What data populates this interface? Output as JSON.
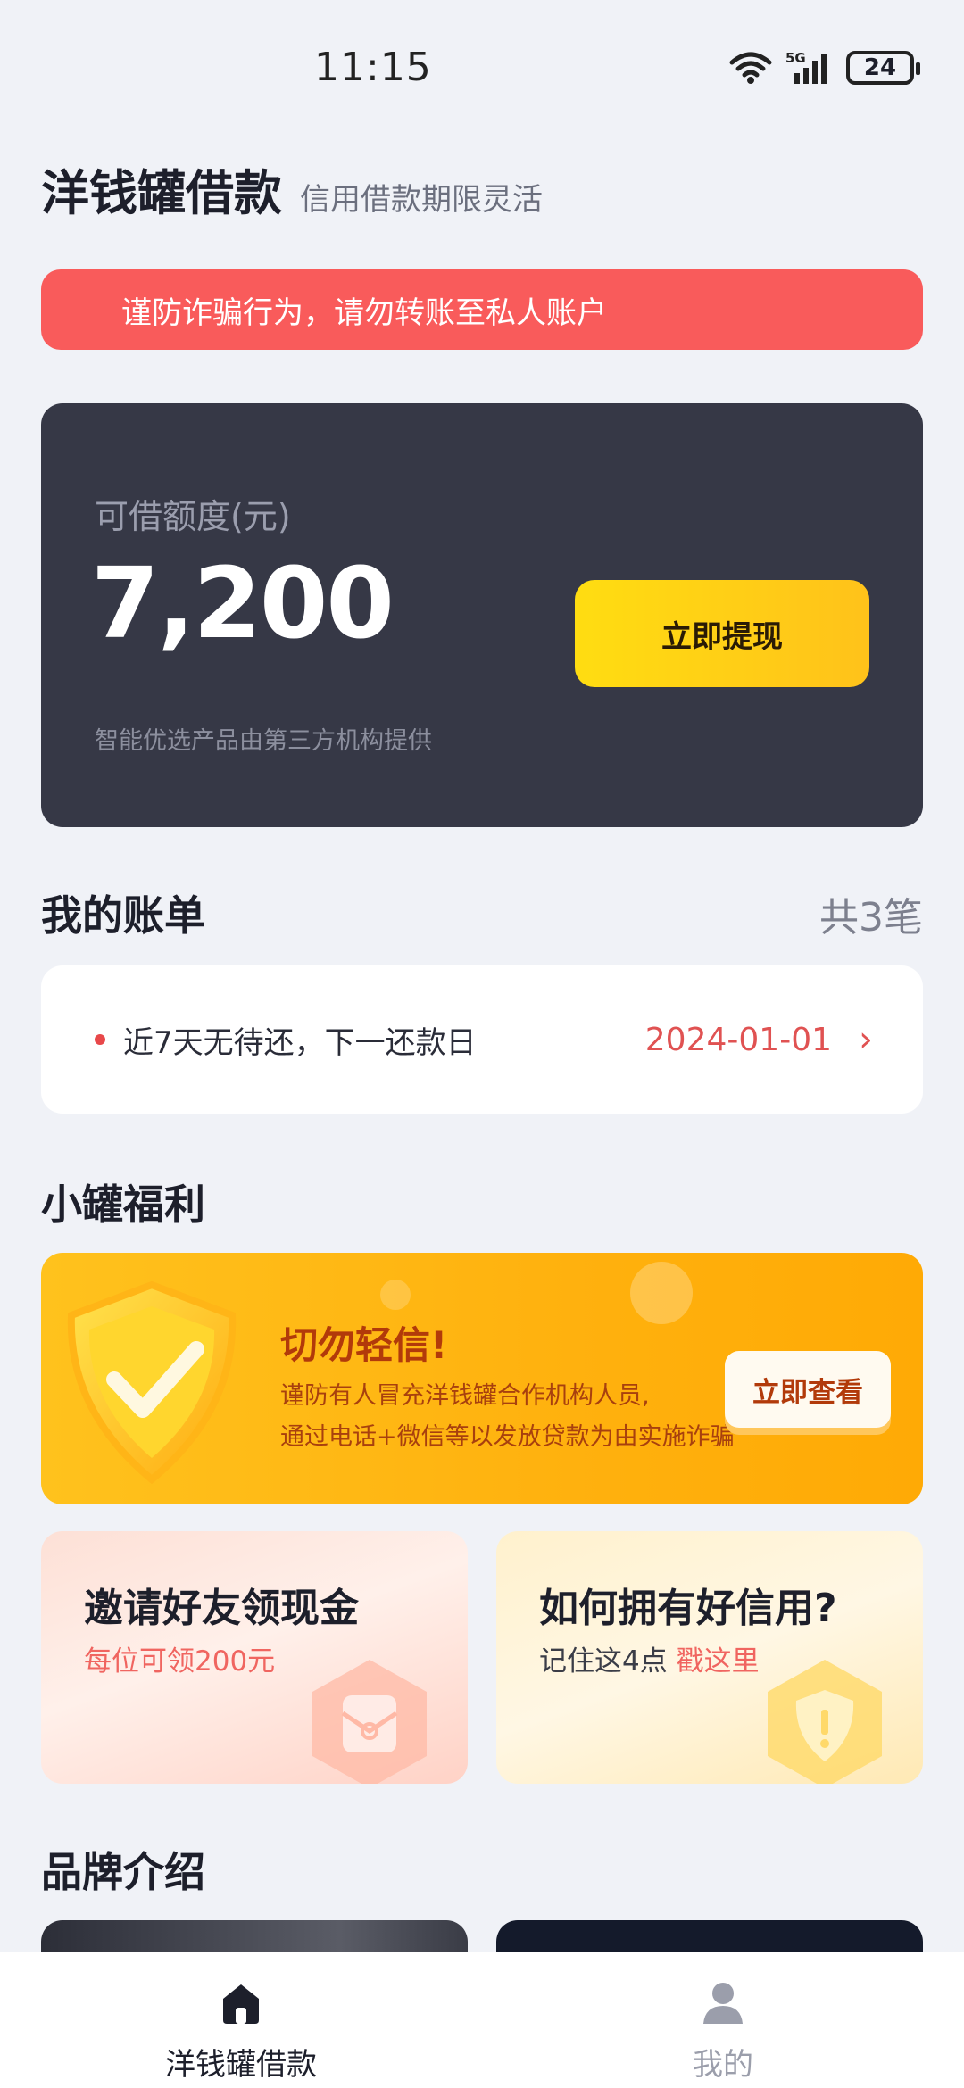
{
  "status_bar": {
    "time": "11:15",
    "network": "5G",
    "battery": "24"
  },
  "header": {
    "title": "洋钱罐借款",
    "subtitle": "信用借款期限灵活"
  },
  "warning": {
    "text": "谨防诈骗行为，请勿转账至私人账户"
  },
  "credit": {
    "label": "可借额度(元)",
    "amount": "7,200",
    "note": "智能优选产品由第三方机构提供",
    "button": "立即提现"
  },
  "bills": {
    "title": "我的账单",
    "count": "共3笔",
    "text": "近7天无待还，下一还款日",
    "date": "2024-01-01"
  },
  "welfare": {
    "title": "小罐福利",
    "banner_title": "切勿轻信!",
    "banner_line1": "谨防有人冒充洋钱罐合作机构人员,",
    "banner_line2": "通过电话+微信等以发放贷款为由实施诈骗",
    "banner_button": "立即查看"
  },
  "cards": {
    "invite_title": "邀请好友领现金",
    "invite_sub": "每位可领200元",
    "credit_title": "如何拥有好信用?",
    "credit_sub": "记住这4点",
    "credit_link": "戳这里"
  },
  "brand": {
    "title": "品牌介绍"
  },
  "nav": {
    "home": "洋钱罐借款",
    "mine": "我的"
  },
  "colors": {
    "accent": "#ffd21a",
    "warning": "#f95b5b",
    "card_dark": "#363846"
  }
}
